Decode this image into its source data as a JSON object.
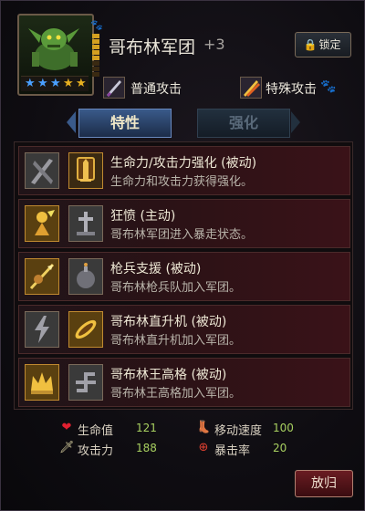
{
  "unit": {
    "name": "哥布林军团",
    "level": "+3",
    "stars_filled": 3,
    "stars_total": 5,
    "level_pips": 8,
    "level_pips_filled": 5
  },
  "header": {
    "lock_label": "锁定",
    "lock_icon": "lock-icon"
  },
  "attacks": {
    "normal_label": "普通攻击",
    "special_label": "特殊攻击"
  },
  "tabs": [
    {
      "label": "特性",
      "active": true
    },
    {
      "label": "强化",
      "active": false
    }
  ],
  "skills": [
    {
      "title": "生命力/攻击力强化 (被动)",
      "desc": "生命力和攻击力获得强化。",
      "icon1": "crossed-swords-icon",
      "icon2": "sword-shield-icon"
    },
    {
      "title": "狂愤 (主动)",
      "desc": "哥布林军团进入暴走状态。",
      "icon1": "rage-warrior-icon",
      "icon2": "cross-tombstone-icon"
    },
    {
      "title": "枪兵支援 (被动)",
      "desc": "哥布林枪兵队加入军团。",
      "icon1": "spearman-icon",
      "icon2": "bomb-creature-icon"
    },
    {
      "title": "哥布林直升机 (被动)",
      "desc": "哥布林直升机加入军团。",
      "icon1": "lightning-bolt-icon",
      "icon2": "helicopter-blade-icon"
    },
    {
      "title": "哥布林王高格 (被动)",
      "desc": "哥布林王高格加入军团。",
      "icon1": "crown-icon",
      "icon2": "swastika-rune-icon"
    }
  ],
  "stats": {
    "hp_label": "生命值",
    "hp_value": "121",
    "speed_label": "移动速度",
    "speed_value": "100",
    "atk_label": "攻击力",
    "atk_value": "188",
    "crit_label": "暴击率",
    "crit_value": "20"
  },
  "footer": {
    "back_label": "放归"
  },
  "colors": {
    "accent_gold": "#d4a020",
    "star_blue": "#4aa0ff",
    "stat_value": "#a8d060",
    "paw_orange": "#ff7030"
  }
}
